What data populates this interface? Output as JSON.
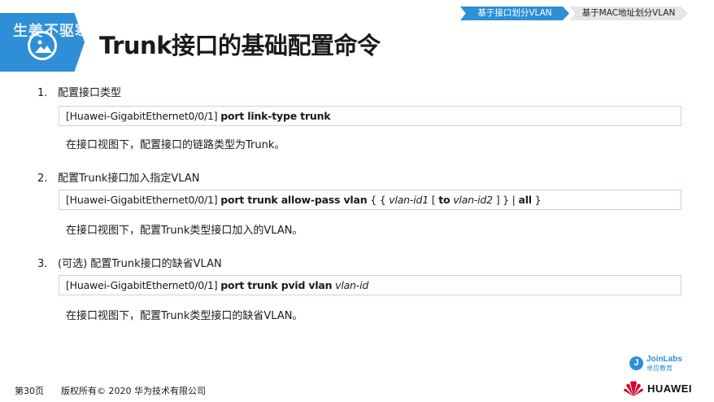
{
  "header": {
    "watermark": "生姜不驱寒",
    "title": "Trunk接口的基础配置命令",
    "logo_icon": "image-icon",
    "accent_color": "#2e8fd6"
  },
  "tabs": [
    {
      "label": "基于接口划分VLAN",
      "active": true
    },
    {
      "label": "基于MAC地址划分VLAN",
      "active": false
    }
  ],
  "steps": [
    {
      "number": "1.",
      "heading": "配置接口类型",
      "cmd_prefix": "[Huawei-GigabitEthernet0/0/1]",
      "cmd_bold": "port link-type trunk",
      "description": "在接口视图下，配置接口的链路类型为Trunk。"
    },
    {
      "number": "2.",
      "heading": "配置Trunk接口加入指定VLAN",
      "cmd_prefix": "[Huawei-GigabitEthernet0/0/1]",
      "cmd_bold": "port trunk allow-pass vlan",
      "cmd_p1": "{ {",
      "cmd_i1": "vlan-id1",
      "cmd_p2": "[",
      "cmd_b2": "to",
      "cmd_i2": "vlan-id2",
      "cmd_p3": "] } |",
      "cmd_b3": "all",
      "cmd_p4": "}",
      "description": "在接口视图下，配置Trunk类型接口加入的VLAN。"
    },
    {
      "number": "3.",
      "heading": "(可选) 配置Trunk接口的缺省VLAN",
      "cmd_prefix": "[Huawei-GigabitEthernet0/0/1]",
      "cmd_bold": "port trunk pvid vlan",
      "cmd_italic": "vlan-id",
      "description": "在接口视图下，配置Trunk类型接口的缺省VLAN。"
    }
  ],
  "footer": {
    "page": "第30页",
    "copyright": "版权所有© 2020 华为技术有限公司",
    "joinlabs_name": "JoinLabs",
    "joinlabs_sub": "卓应教育",
    "joinlabs_mark": "J",
    "brand": "HUAWEI",
    "brand_color": "#cf0a2c"
  }
}
